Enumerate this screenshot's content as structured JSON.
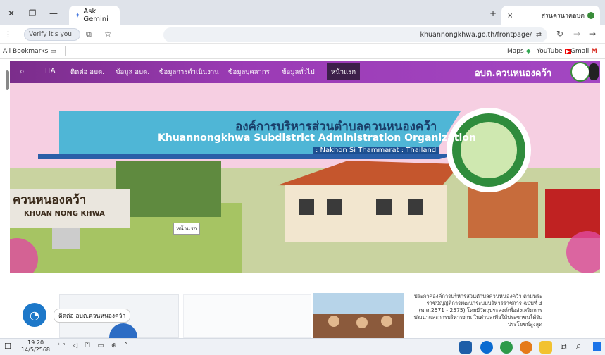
{
  "browser": {
    "tab_title": "Ask Gemini",
    "tab2_title": "สรนครนาคอบต",
    "new_tab_symbol": "+",
    "close_symbol": "×",
    "url": "khuannongkhwa.go.th/frontpage/",
    "profile_pill": "Verify it's you",
    "bookmarks": [
      "Gmail",
      "YouTube",
      "Maps"
    ],
    "all_bookmarks": "All Bookmarks"
  },
  "site": {
    "logo_text": "อบต.ควนหนองคว้า",
    "nav": [
      "หน้าแรก",
      "ข้อมูลทั่วไป",
      "ข้อมูลบุคลากร",
      "ข้อมูลการดำเนินงาน",
      "ข้อมูล อบต.",
      "ติดต่อ อบต.",
      "ITA"
    ],
    "hero_thai": "องค์การบริหารส่วนตำบลควนหนองคว้า",
    "hero_en": "Khuannongkhwa Subdistrict Administration Organization",
    "hero_loc": ": Nakhon Si Thammarat : Thailand",
    "sign_thai": "ควนหนองคว้า",
    "sign_en": "KHUAN NONG KHWA",
    "hero_tag": "หน้าแรก",
    "chat_label": "ติดต่อ อบต.ควนหนองคว้า",
    "news_text": "ประกาศองค์การบริหารส่วนตำบลควนหนองคว้า ตามพระราชบัญญัติการพัฒนาระบบบริหารราชการ ฉบับที่ 3 (พ.ศ.2571 - 2575) โดยมีวัตถุประสงค์เพื่อส่งเสริมการพัฒนาและการบริหารงาน ในตำบลเพื่อให้ประชาชนได้รับประโยชน์สูงสุด"
  },
  "taskbar": {
    "time": "19:20",
    "date": "14/5/2568"
  },
  "colors": {
    "nav_purple": "#9b3bb5",
    "accent_blue": "#1a73e8",
    "chat_blue": "#1d78c9"
  }
}
